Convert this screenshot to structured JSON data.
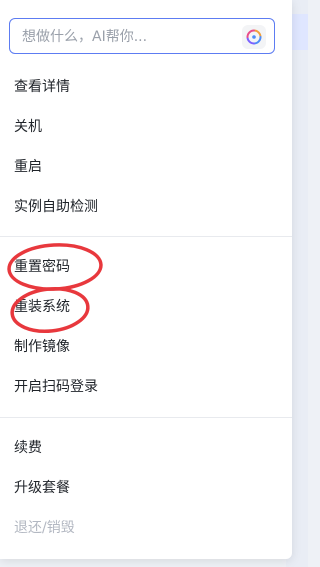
{
  "search": {
    "placeholder": "想做什么，AI帮你...",
    "ai_icon": "ai-sparkle-icon"
  },
  "groups": [
    {
      "items": [
        {
          "label": "查看详情"
        },
        {
          "label": "关机"
        },
        {
          "label": "重启"
        },
        {
          "label": "实例自助检测"
        }
      ]
    },
    {
      "items": [
        {
          "label": "重置密码"
        },
        {
          "label": "重装系统"
        },
        {
          "label": "制作镜像"
        },
        {
          "label": "开启扫码登录"
        }
      ]
    },
    {
      "items": [
        {
          "label": "续费"
        },
        {
          "label": "升级套餐"
        },
        {
          "label": "退还/销毁",
          "disabled": true
        }
      ]
    }
  ],
  "annotations": {
    "highlight_color": "#e8383d"
  },
  "colors": {
    "accent": "#5d7cf2",
    "text": "#1f2329",
    "disabled": "#b3b8c2"
  }
}
